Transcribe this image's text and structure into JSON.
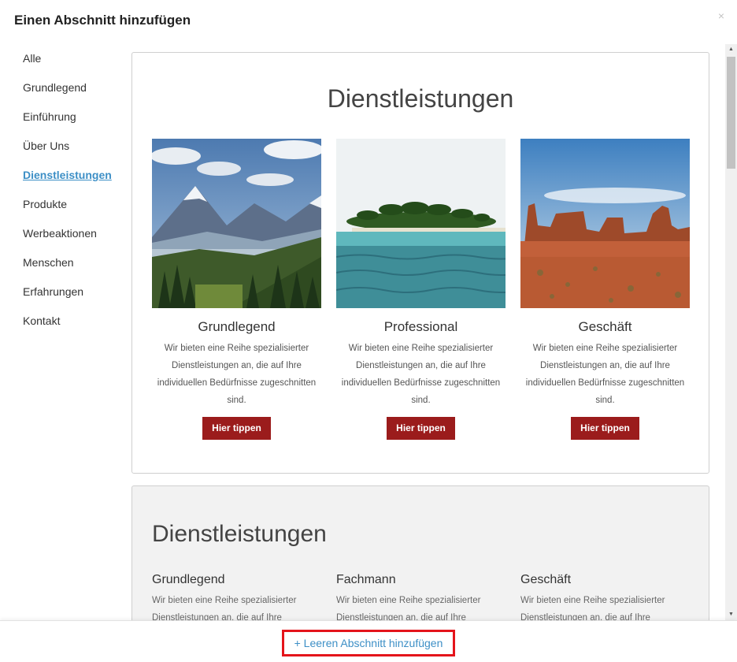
{
  "dialog": {
    "title": "Einen Abschnitt hinzufügen",
    "close_label": "×"
  },
  "sidebar": {
    "items": [
      {
        "label": "Alle"
      },
      {
        "label": "Grundlegend"
      },
      {
        "label": "Einführung"
      },
      {
        "label": "Über Uns"
      },
      {
        "label": "Dienstleistungen",
        "active": true
      },
      {
        "label": "Produkte"
      },
      {
        "label": "Werbeaktionen"
      },
      {
        "label": "Menschen"
      },
      {
        "label": "Erfahrungen"
      },
      {
        "label": "Kontakt"
      }
    ]
  },
  "card1": {
    "heading": "Dienstleistungen",
    "columns": [
      {
        "title": "Grundlegend",
        "text": "Wir bieten eine Reihe spezialisierter Dienstleistungen an, die auf Ihre individuellen Bedürfnisse zugeschnitten sind.",
        "button": "Hier tippen"
      },
      {
        "title": "Professional",
        "text": "Wir bieten eine Reihe spezialisierter Dienstleistungen an, die auf Ihre individuellen Bedürfnisse zugeschnitten sind.",
        "button": "Hier tippen"
      },
      {
        "title": "Geschäft",
        "text": "Wir bieten eine Reihe spezialisierter Dienstleistungen an, die auf Ihre individuellen Bedürfnisse zugeschnitten sind.",
        "button": "Hier tippen"
      }
    ]
  },
  "card2": {
    "heading": "Dienstleistungen",
    "columns": [
      {
        "title": "Grundlegend",
        "text": "Wir bieten eine Reihe spezialisierter Dienstleistungen an, die auf Ihre individuellen Bedürfnisse zugeschnitten sind."
      },
      {
        "title": "Fachmann",
        "text": "Wir bieten eine Reihe spezialisierter Dienstleistungen an, die auf Ihre individuellen Bedürfnisse zugeschnitten sind."
      },
      {
        "title": "Geschäft",
        "text": "Wir bieten eine Reihe spezialisierter Dienstleistungen an, die auf Ihre individuellen Bedürfnisse zugeschnitten sind."
      }
    ]
  },
  "footer": {
    "add_empty_label": "+ Leeren Abschnitt hinzufügen"
  },
  "colors": {
    "accent": "#3d8fc6",
    "button": "#9b1c1c",
    "highlight": "#e4141b"
  },
  "icons": {
    "close": "close-icon",
    "scroll_up": "scroll-up-icon",
    "scroll_down": "scroll-down-icon"
  }
}
